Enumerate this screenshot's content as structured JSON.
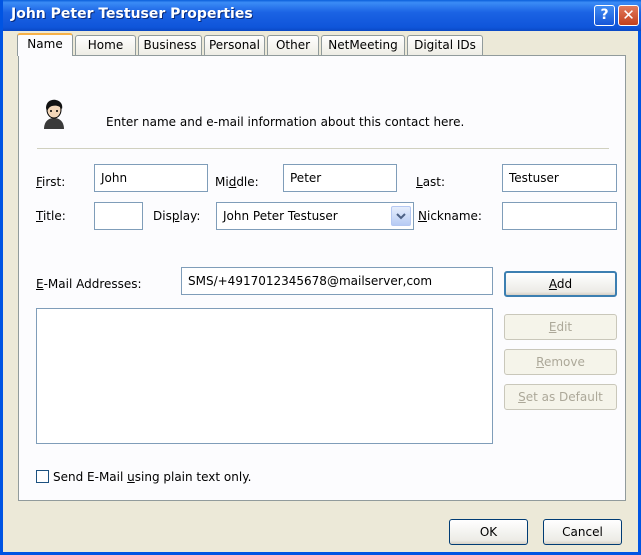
{
  "window": {
    "title": "John Peter Testuser Properties",
    "help_glyph": "?",
    "close_glyph": "✕"
  },
  "tabs": [
    "Name",
    "Home",
    "Business",
    "Personal",
    "Other",
    "NetMeeting",
    "Digital IDs"
  ],
  "header": {
    "description": "Enter name and e-mail information about this contact here."
  },
  "fields": {
    "first_label": "First:",
    "first_value": "John",
    "middle_label": "Middle:",
    "middle_value": "Peter",
    "last_label": "Last:",
    "last_value": "Testuser",
    "title_label": "Title:",
    "title_value": "",
    "display_label": "Display:",
    "display_value": "John Peter Testuser",
    "nickname_label": "Nickname:",
    "nickname_value": ""
  },
  "email": {
    "label": "E-Mail Addresses:",
    "input_value": "SMS/+4917012345678@mailserver,com",
    "add": "Add",
    "edit": "Edit",
    "remove": "Remove",
    "set_default": "Set as Default",
    "list_items": []
  },
  "plain_text_checkbox": {
    "label": "Send E-Mail using plain text only.",
    "checked": false
  },
  "footer": {
    "ok": "OK",
    "cancel": "Cancel"
  }
}
